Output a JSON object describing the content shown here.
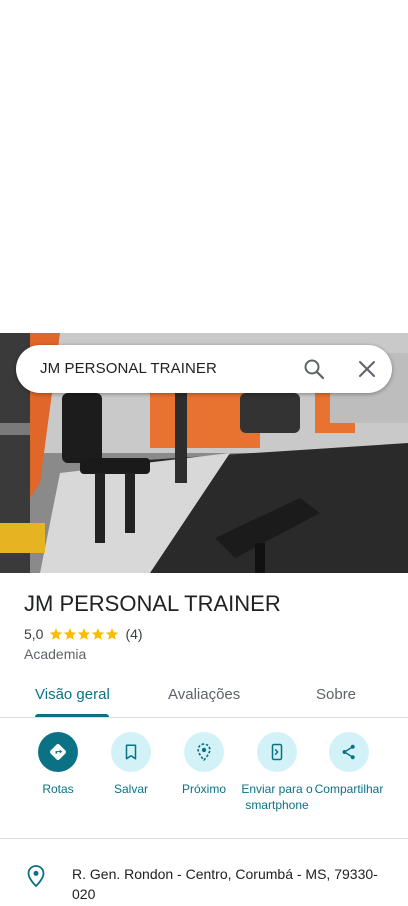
{
  "search": {
    "query": "JM PERSONAL TRAINER"
  },
  "place": {
    "title": "JM PERSONAL TRAINER",
    "rating": "5,0",
    "stars": 5,
    "review_count": "(4)",
    "category": "Academia"
  },
  "tabs": [
    {
      "label": "Visão geral",
      "active": true
    },
    {
      "label": "Avaliações",
      "active": false
    },
    {
      "label": "Sobre",
      "active": false
    }
  ],
  "actions": [
    {
      "label": "Rotas",
      "icon": "directions-icon"
    },
    {
      "label": "Salvar",
      "icon": "bookmark-icon"
    },
    {
      "label": "Próximo",
      "icon": "nearby-icon"
    },
    {
      "label": "Enviar para o smartphone",
      "icon": "send-to-phone-icon"
    },
    {
      "label": "Compartilhar",
      "icon": "share-icon"
    }
  ],
  "address": {
    "text": "R. Gen. Rondon - Centro, Corumbá - MS, 79330-020"
  },
  "colors": {
    "accent": "#0b7285",
    "accent_light": "#d2f2f7",
    "star": "#fbbc04"
  }
}
